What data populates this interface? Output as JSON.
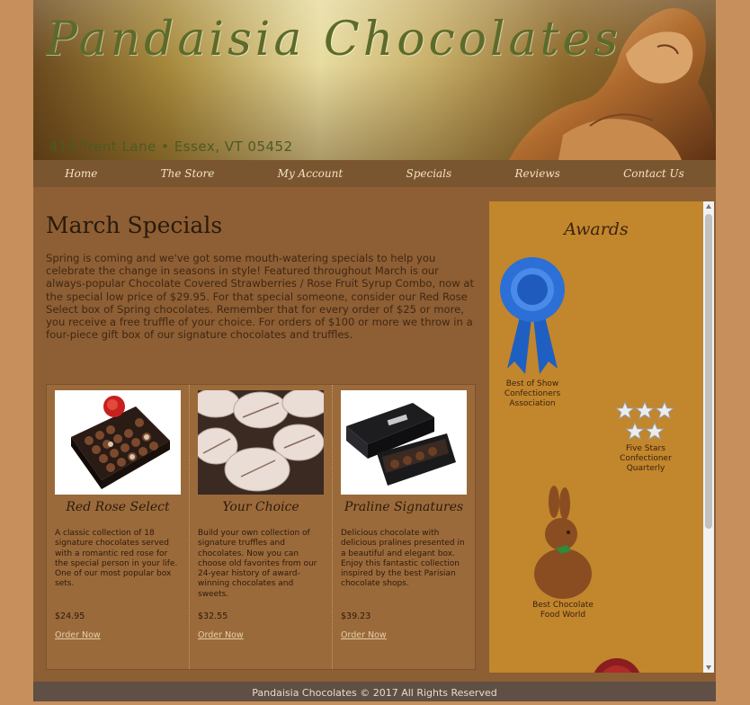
{
  "header": {
    "brand": "Pandaisia Chocolates",
    "address": "414 Trent Lane • Essex, VT 05452"
  },
  "nav": {
    "items": [
      "Home",
      "The Store",
      "My Account",
      "Specials",
      "Reviews",
      "Contact Us"
    ]
  },
  "main": {
    "title": "March Specials",
    "intro": "Spring is coming and we've got some mouth-watering specials to help you celebrate the change in seasons in style! Featured throughout March is our always-popular Chocolate Covered Strawberries / Rose Fruit Syrup Combo, now at the special low price of $29.95. For that special someone, consider our Red Rose Select box of Spring chocolates. Remember that for every order of $25 or more, you receive a free truffle of your choice. For orders of $100 or more we throw in a four-piece gift box of our signature chocolates and truffles."
  },
  "products": [
    {
      "name": "Red Rose Select",
      "description": "A classic collection of 18 signature chocolates served with a romantic red rose for the special person in your life. One of our most popular box sets.",
      "price": "$24.95",
      "order_label": "Order Now"
    },
    {
      "name": "Your Choice",
      "description": "Build your own collection of signature truffles and chocolates. Now you can choose old favorites from our 24-year history of award-winning chocolates and sweets.",
      "price": "$32.55",
      "order_label": "Order Now"
    },
    {
      "name": "Praline Signatures",
      "description": "Delicious chocolate with delicious pralines presented in a beautiful and elegant box. Enjoy this fantastic collection inspired by the best Parisian chocolate shops.",
      "price": "$39.23",
      "order_label": "Order Now"
    }
  ],
  "awards": {
    "title": "Awards",
    "items": [
      {
        "label": "Best of Show Confectioners Association",
        "icon": "ribbon-icon"
      },
      {
        "label": "Five Stars Confectioner Quarterly",
        "icon": "stars-icon"
      },
      {
        "label": "Best Chocolate Food World",
        "icon": "chocolate-bunny-icon"
      }
    ]
  },
  "footer": {
    "text": "Pandaisia Chocolates © 2017 All Rights Reserved"
  },
  "colors": {
    "background": "#c68f5c",
    "content": "#8e5f34",
    "nav": "#7a5630",
    "awards_panel": "#c2862c",
    "footer": "#5f4f44"
  }
}
